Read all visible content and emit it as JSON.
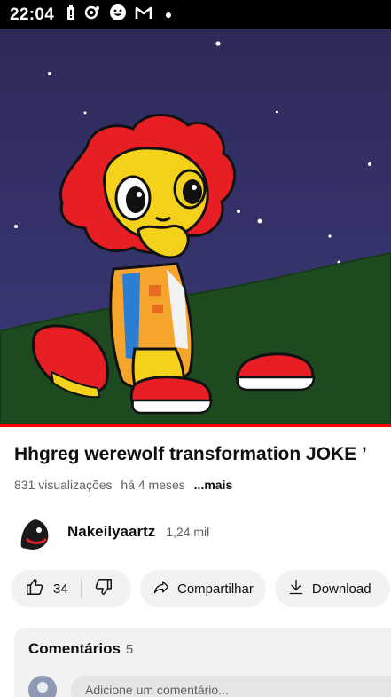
{
  "status_bar": {
    "time": "22:04",
    "icons": [
      "battery-icon",
      "lens-icon",
      "smiley-icon",
      "gmail-icon",
      "notification-dot-icon"
    ]
  },
  "video": {
    "title": "Hhgreg werewolf transformation JOKE ’",
    "views": "831 visualizações",
    "age": "há 4 meses",
    "more": "...mais",
    "progress_color": "#ff0000"
  },
  "channel": {
    "name": "Nakeilyaartz",
    "subscribers": "1,24 mil"
  },
  "actions": {
    "like_count": "34",
    "share_label": "Compartilhar",
    "download_label": "Download"
  },
  "comments": {
    "heading": "Comentários",
    "count": "5",
    "placeholder": "Adicione um comentário..."
  }
}
